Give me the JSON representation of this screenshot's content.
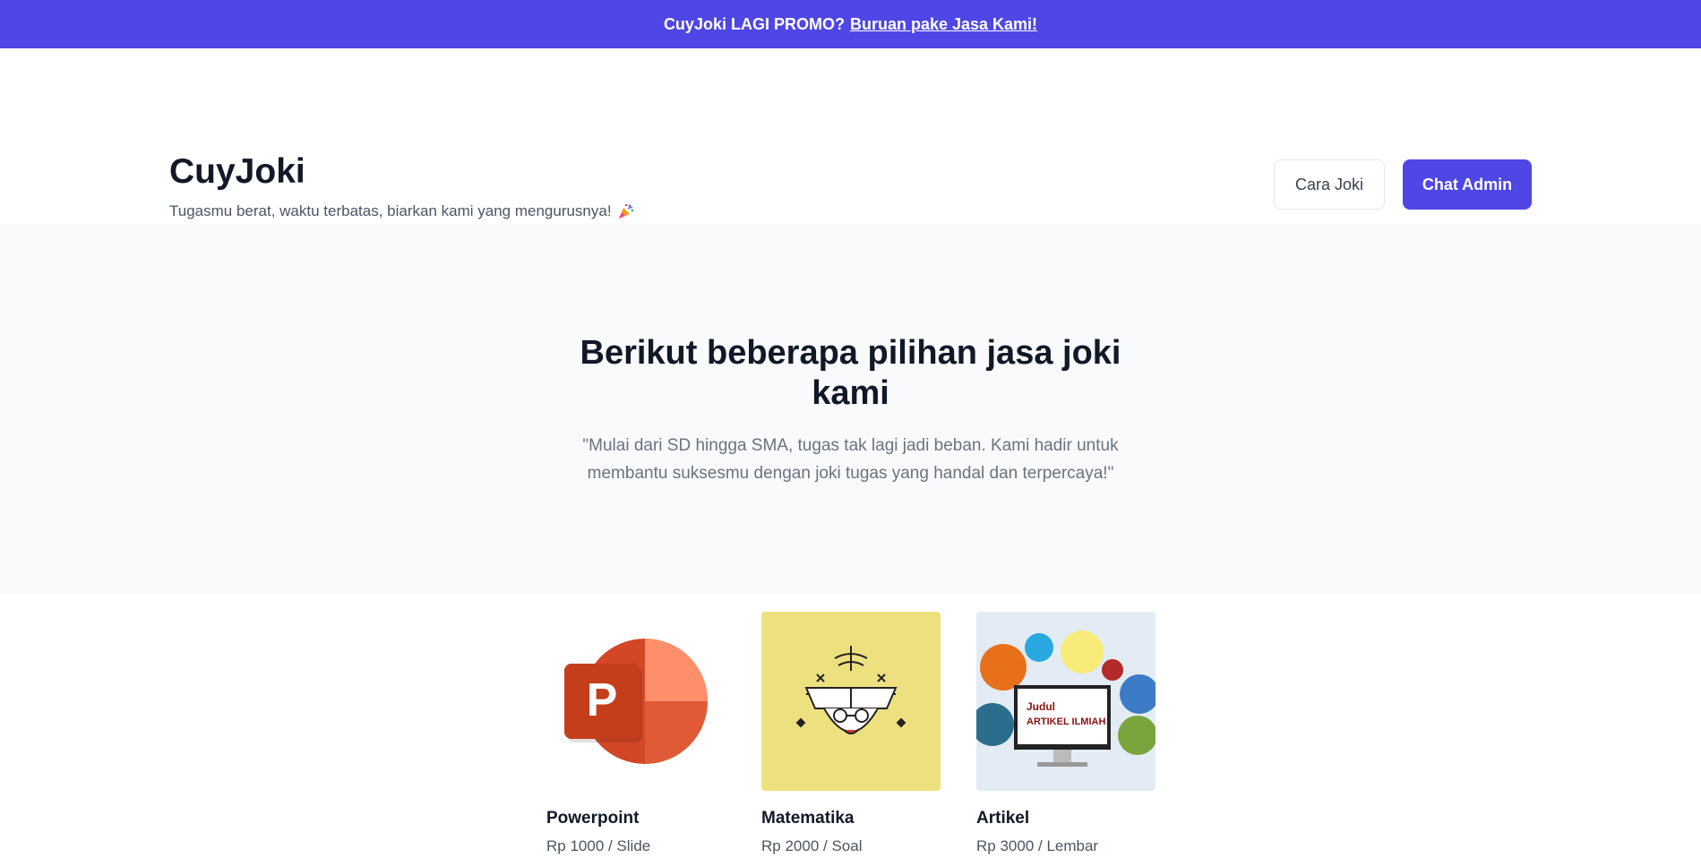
{
  "promo": {
    "text": "CuyJoki LAGI PROMO?",
    "link": "Buruan pake Jasa Kami!"
  },
  "header": {
    "brand": "CuyJoki",
    "tagline": "Tugasmu berat, waktu terbatas, biarkan kami yang mengurusnya!",
    "tagline_icon": "party-popper-icon",
    "cara_joki_label": "Cara Joki",
    "chat_admin_label": "Chat Admin"
  },
  "hero": {
    "title": "Berikut beberapa pilihan jasa joki kami",
    "quote": "\"Mulai dari SD hingga SMA, tugas tak lagi jadi beban. Kami hadir untuk membantu suksesmu dengan joki tugas yang handal dan terpercaya!\""
  },
  "products": [
    {
      "name": "Powerpoint",
      "price": "Rp 1000 / Slide",
      "icon": "powerpoint-icon",
      "bg": "#ffffff"
    },
    {
      "name": "Matematika",
      "price": "Rp 2000 / Soal",
      "icon": "math-student-icon",
      "bg": "#ede17f"
    },
    {
      "name": "Artikel",
      "price": "Rp 3000 / Lembar",
      "icon": "scientific-article-icon",
      "bg": "#e3ecf5",
      "image_text": {
        "line1": "Judul",
        "line2": "ARTIKEL ILMIAH"
      }
    }
  ],
  "colors": {
    "accent": "#4f46e5",
    "hero_bg": "#f9fafb"
  }
}
